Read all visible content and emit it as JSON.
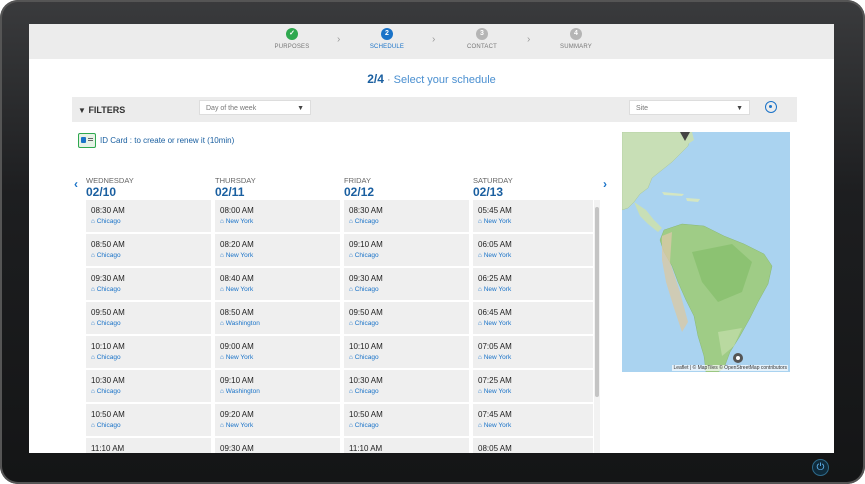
{
  "stepper": {
    "steps": [
      {
        "number": "✓",
        "label": "PURPOSES",
        "state": "done"
      },
      {
        "number": "2",
        "label": "SCHEDULE",
        "state": "active"
      },
      {
        "number": "3",
        "label": "CONTACT",
        "state": "todo"
      },
      {
        "number": "4",
        "label": "SUMMARY",
        "state": "todo"
      }
    ]
  },
  "heading": {
    "step": "2/4",
    "separator": "·",
    "text": "Select your schedule"
  },
  "filters": {
    "label": "FILTERS",
    "day_select": {
      "value": "Day of the week"
    },
    "site_select": {
      "value": "Site"
    }
  },
  "id_card": {
    "text": "ID Card : to create or renew it (10min)"
  },
  "calendar": {
    "prev": "‹",
    "next": "›",
    "days": [
      {
        "name": "WEDNESDAY",
        "date": "02/10",
        "slots": [
          {
            "time": "08:30 AM",
            "city": "Chicago"
          },
          {
            "time": "08:50 AM",
            "city": "Chicago"
          },
          {
            "time": "09:30 AM",
            "city": "Chicago"
          },
          {
            "time": "09:50 AM",
            "city": "Chicago"
          },
          {
            "time": "10:10 AM",
            "city": "Chicago"
          },
          {
            "time": "10:30 AM",
            "city": "Chicago"
          },
          {
            "time": "10:50 AM",
            "city": "Chicago"
          },
          {
            "time": "11:10 AM",
            "city": ""
          }
        ]
      },
      {
        "name": "THURSDAY",
        "date": "02/11",
        "slots": [
          {
            "time": "08:00 AM",
            "city": "New York"
          },
          {
            "time": "08:20 AM",
            "city": "New York"
          },
          {
            "time": "08:40 AM",
            "city": "New York"
          },
          {
            "time": "08:50 AM",
            "city": "Washington"
          },
          {
            "time": "09:00 AM",
            "city": "New York"
          },
          {
            "time": "09:10 AM",
            "city": "Washington"
          },
          {
            "time": "09:20 AM",
            "city": "New York"
          },
          {
            "time": "09:30 AM",
            "city": ""
          }
        ]
      },
      {
        "name": "FRIDAY",
        "date": "02/12",
        "slots": [
          {
            "time": "08:30 AM",
            "city": "Chicago"
          },
          {
            "time": "09:10 AM",
            "city": "Chicago"
          },
          {
            "time": "09:30 AM",
            "city": "Chicago"
          },
          {
            "time": "09:50 AM",
            "city": "Chicago"
          },
          {
            "time": "10:10 AM",
            "city": "Chicago"
          },
          {
            "time": "10:30 AM",
            "city": "Chicago"
          },
          {
            "time": "10:50 AM",
            "city": "Chicago"
          },
          {
            "time": "11:10 AM",
            "city": ""
          }
        ]
      },
      {
        "name": "SATURDAY",
        "date": "02/13",
        "slots": [
          {
            "time": "05:45 AM",
            "city": "New York"
          },
          {
            "time": "06:05 AM",
            "city": "New York"
          },
          {
            "time": "06:25 AM",
            "city": "New York"
          },
          {
            "time": "06:45 AM",
            "city": "New York"
          },
          {
            "time": "07:05 AM",
            "city": "New York"
          },
          {
            "time": "07:25 AM",
            "city": "New York"
          },
          {
            "time": "07:45 AM",
            "city": "New York"
          },
          {
            "time": "08:05 AM",
            "city": ""
          }
        ]
      }
    ]
  },
  "map": {
    "attribution": "Leaflet | © MapTiles © OpenStreetMap contributors"
  },
  "colors": {
    "accent": "#1a73c8",
    "done": "#2fa84f",
    "panel": "#ececec"
  }
}
